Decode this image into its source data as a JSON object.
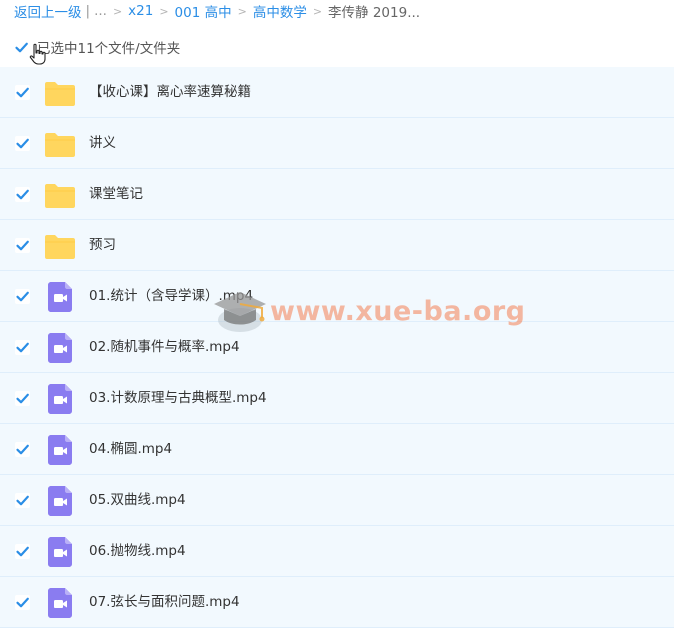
{
  "breadcrumb": {
    "back": "返回上一级",
    "ellipsis": "...",
    "sep": ">",
    "items": [
      "x21",
      "001 高中",
      "高中数学"
    ],
    "current": "李传静 2019..."
  },
  "selection": {
    "label": "已选中11个文件/文件夹"
  },
  "files": [
    {
      "name": "【收心课】离心率速算秘籍",
      "type": "folder"
    },
    {
      "name": "讲义",
      "type": "folder"
    },
    {
      "name": "课堂笔记",
      "type": "folder"
    },
    {
      "name": "预习",
      "type": "folder"
    },
    {
      "name": "01.统计（含导学课）.mp4",
      "type": "video"
    },
    {
      "name": "02.随机事件与概率.mp4",
      "type": "video"
    },
    {
      "name": "03.计数原理与古典概型.mp4",
      "type": "video"
    },
    {
      "name": "04.椭圆.mp4",
      "type": "video"
    },
    {
      "name": "05.双曲线.mp4",
      "type": "video"
    },
    {
      "name": "06.抛物线.mp4",
      "type": "video"
    },
    {
      "name": "07.弦长与面积问题.mp4",
      "type": "video"
    }
  ],
  "watermark": {
    "text": "www.xue-ba.org"
  },
  "colors": {
    "link": "#2b8ee6",
    "check": "#2b8ee6",
    "folder": "#ffd65e",
    "video": "#8a7cf0",
    "row_bg": "#f2f9fe"
  }
}
